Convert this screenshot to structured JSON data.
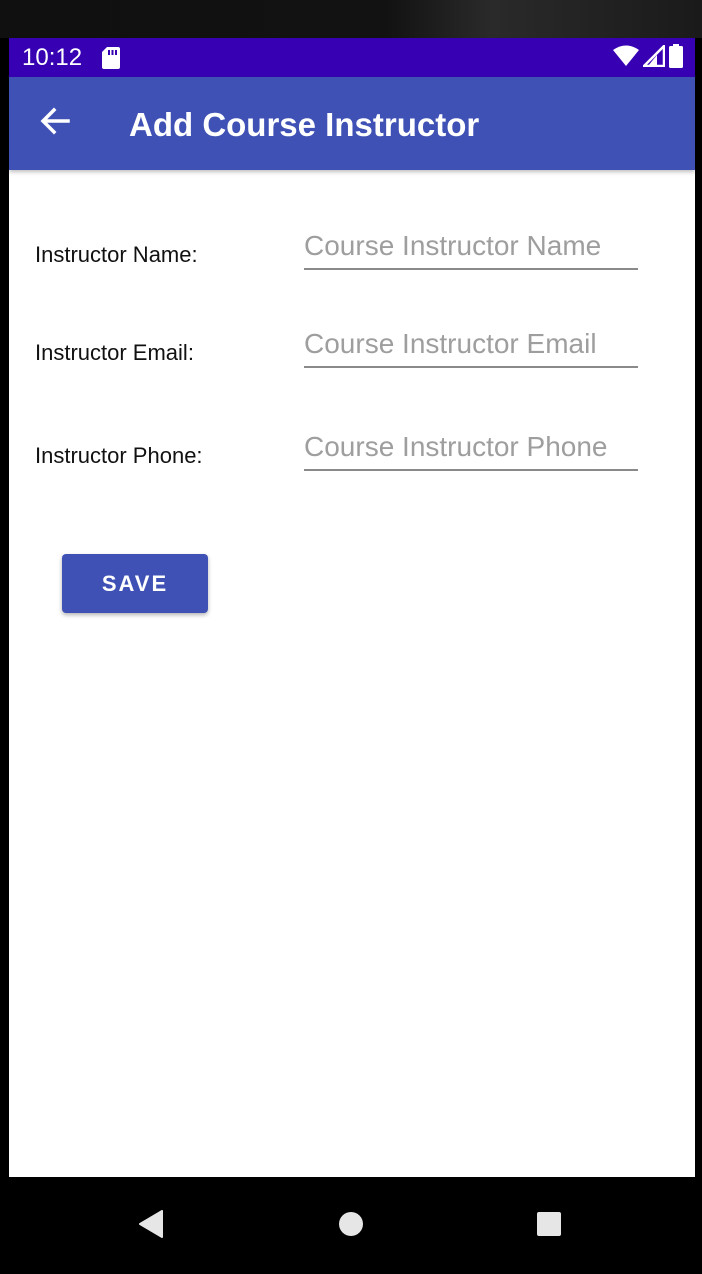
{
  "status_bar": {
    "time": "10:12",
    "icons": [
      "sd-card-icon",
      "wifi-icon",
      "cellular-signal-icon",
      "battery-icon"
    ],
    "background_color": "#3700b3"
  },
  "app_bar": {
    "title": "Add Course Instructor",
    "back_icon": "arrow-left-icon",
    "background_color": "#3f51b5"
  },
  "form": {
    "name": {
      "label": "Instructor Name:",
      "value": "",
      "placeholder": "Course Instructor Name"
    },
    "email": {
      "label": "Instructor Email:",
      "value": "",
      "placeholder": "Course Instructor Email"
    },
    "phone": {
      "label": "Instructor Phone:",
      "value": "",
      "placeholder": "Course Instructor Phone"
    }
  },
  "save_button": {
    "label": "SAVE"
  },
  "nav_bar": {
    "icons": [
      "back-triangle-icon",
      "home-circle-icon",
      "recents-square-icon"
    ]
  }
}
